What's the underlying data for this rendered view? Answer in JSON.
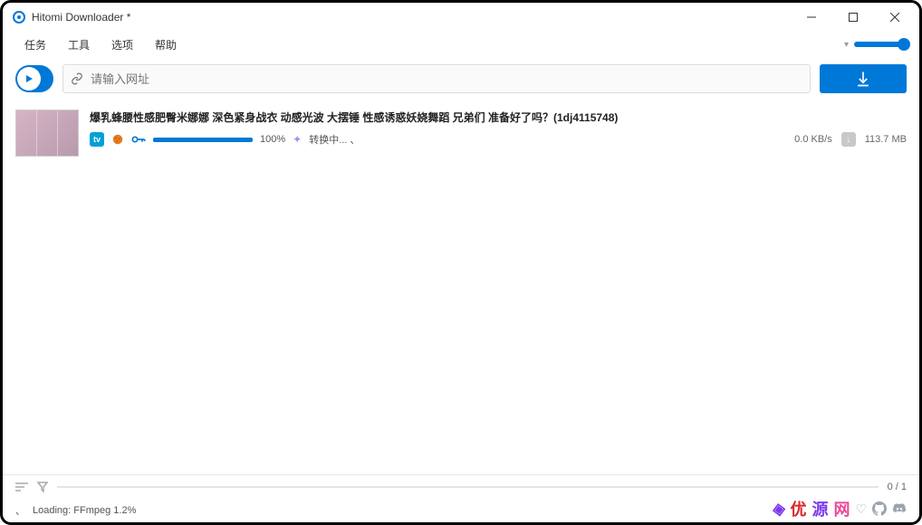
{
  "title": "Hitomi Downloader *",
  "menu": {
    "tasks": "任务",
    "tools": "工具",
    "options": "选项",
    "help": "帮助"
  },
  "url_placeholder": "请输入网址",
  "item": {
    "title": "爆乳蜂腰性感肥臀米娜娜 深色紧身战衣  动感光波  大摆锤 性感诱惑妖娆舞蹈  兄弟们 准备好了吗？(1dj4115748)",
    "percent": "100%",
    "status": "转换中... 、",
    "speed": "0.0 KB/s",
    "size": "113.7 MB"
  },
  "footer": {
    "counter": "0 / 1",
    "loading": "Loading: FFmpeg 1.2%"
  }
}
